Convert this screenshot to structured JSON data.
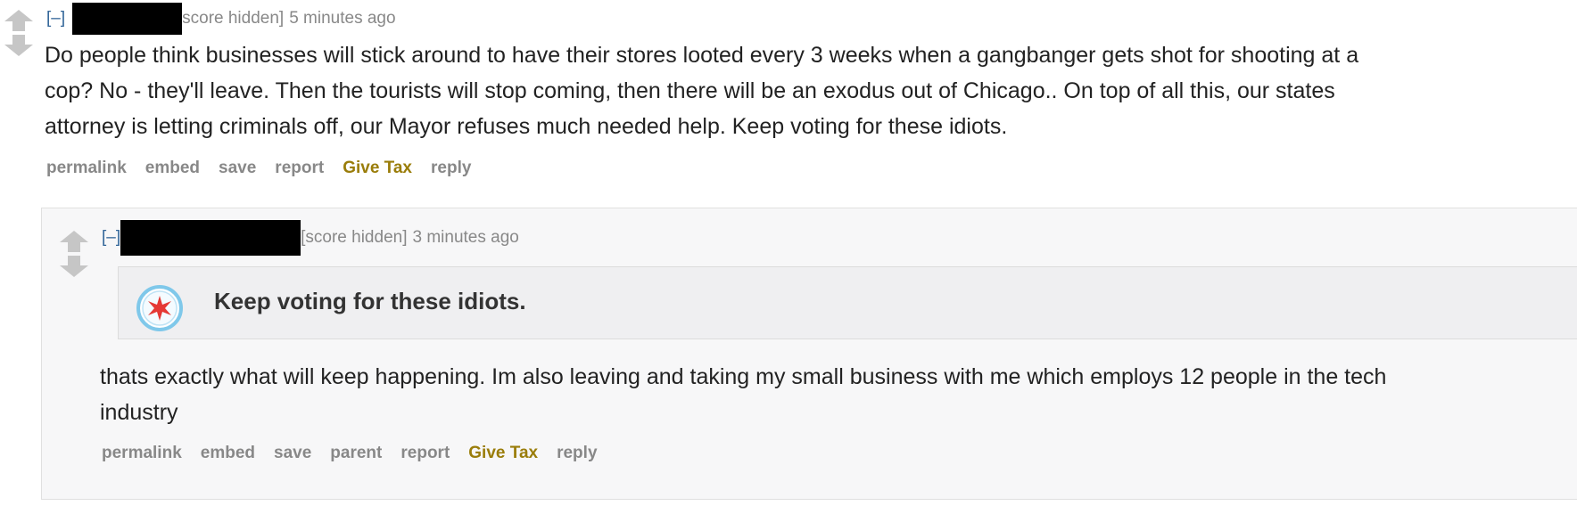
{
  "parent_comment": {
    "collapse_toggle": "[–]",
    "score": "score hidden]",
    "age": "5 minutes ago",
    "body_lines": [
      "Do people think businesses will stick around to have their stores looted every 3 weeks when a gangbanger gets shot for shooting at a",
      "cop? No - they'll leave. Then the tourists will stop coming, then there will be an exodus out of Chicago.. On top of all this, our states",
      "attorney is letting criminals off, our Mayor refuses much needed help. Keep voting for these idiots."
    ],
    "actions": {
      "permalink": "permalink",
      "embed": "embed",
      "save": "save",
      "report": "report",
      "give_tax": "Give Tax",
      "reply": "reply"
    }
  },
  "child_comment": {
    "collapse_toggle": "[–]",
    "score": "[score hidden]",
    "age": "3 minutes ago",
    "quote": "Keep voting for these idiots.",
    "body_lines": [
      "thats exactly what will keep happening. Im also leaving and taking my small business with me which employs 12 people in the tech",
      "industry"
    ],
    "actions": {
      "permalink": "permalink",
      "embed": "embed",
      "save": "save",
      "parent": "parent",
      "report": "report",
      "give_tax": "Give Tax",
      "reply": "reply"
    }
  },
  "colors": {
    "gold_action": "#9a7d0a",
    "muted": "#888888",
    "body_text": "#222222",
    "flair_star": "#e53935",
    "flair_ring": "#7fc8ea"
  },
  "icons": {
    "upvote": "up-arrow-icon",
    "downvote": "down-arrow-icon",
    "flair": "chicago-star-icon"
  }
}
